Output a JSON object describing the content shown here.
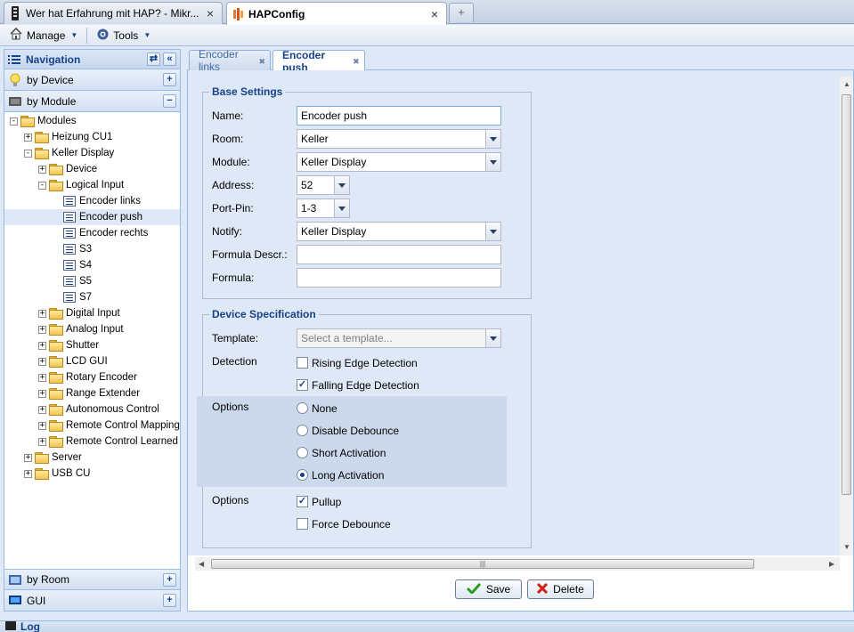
{
  "browser": {
    "tabs": [
      {
        "title": "Wer hat Erfahrung mit HAP? - Mikr...",
        "close": "×"
      },
      {
        "title": "HAPConfig",
        "close": "×"
      }
    ],
    "new_tab": "+"
  },
  "toolbar": {
    "manage": "Manage",
    "tools": "Tools"
  },
  "navigation": {
    "title": "Navigation",
    "sections": {
      "by_device": "by Device",
      "by_module": "by Module",
      "by_room": "by Room",
      "gui": "GUI"
    },
    "tree": [
      {
        "label": "Modules",
        "level": 0,
        "type": "folder",
        "expand": "-"
      },
      {
        "label": "Heizung CU1",
        "level": 1,
        "type": "folder",
        "expand": "+"
      },
      {
        "label": "Keller Display",
        "level": 1,
        "type": "folder",
        "expand": "-"
      },
      {
        "label": "Device",
        "level": 2,
        "type": "folder",
        "expand": "+"
      },
      {
        "label": "Logical Input",
        "level": 2,
        "type": "folder",
        "expand": "-"
      },
      {
        "label": "Encoder links",
        "level": 3,
        "type": "leaf"
      },
      {
        "label": "Encoder push",
        "level": 3,
        "type": "leaf",
        "selected": true
      },
      {
        "label": "Encoder rechts",
        "level": 3,
        "type": "leaf"
      },
      {
        "label": "S3",
        "level": 3,
        "type": "leaf"
      },
      {
        "label": "S4",
        "level": 3,
        "type": "leaf"
      },
      {
        "label": "S5",
        "level": 3,
        "type": "leaf"
      },
      {
        "label": "S7",
        "level": 3,
        "type": "leaf"
      },
      {
        "label": "Digital Input",
        "level": 2,
        "type": "folder",
        "expand": "+"
      },
      {
        "label": "Analog Input",
        "level": 2,
        "type": "folder",
        "expand": "+"
      },
      {
        "label": "Shutter",
        "level": 2,
        "type": "folder",
        "expand": "+"
      },
      {
        "label": "LCD GUI",
        "level": 2,
        "type": "folder",
        "expand": "+"
      },
      {
        "label": "Rotary Encoder",
        "level": 2,
        "type": "folder",
        "expand": "+"
      },
      {
        "label": "Range Extender",
        "level": 2,
        "type": "folder",
        "expand": "+"
      },
      {
        "label": "Autonomous Control",
        "level": 2,
        "type": "folder",
        "expand": "+"
      },
      {
        "label": "Remote Control Mapping",
        "level": 2,
        "type": "folder",
        "expand": "+"
      },
      {
        "label": "Remote Control Learned",
        "level": 2,
        "type": "folder",
        "expand": "+"
      },
      {
        "label": "Server",
        "level": 1,
        "type": "folder",
        "expand": "+"
      },
      {
        "label": "USB CU",
        "level": 1,
        "type": "folder",
        "expand": "+"
      }
    ]
  },
  "tabs": [
    {
      "label": "Encoder links"
    },
    {
      "label": "Encoder push"
    }
  ],
  "base_settings": {
    "legend": "Base Settings",
    "name_label": "Name:",
    "name_value": "Encoder push",
    "room_label": "Room:",
    "room_value": "Keller",
    "module_label": "Module:",
    "module_value": "Keller Display",
    "address_label": "Address:",
    "address_value": "52",
    "portpin_label": "Port-Pin:",
    "portpin_value": "1-3",
    "notify_label": "Notify:",
    "notify_value": "Keller Display",
    "formula_descr_label": "Formula Descr.:",
    "formula_descr_value": "",
    "formula_label": "Formula:",
    "formula_value": ""
  },
  "device_spec": {
    "legend": "Device Specification",
    "template_label": "Template:",
    "template_placeholder": "Select a template...",
    "detection_label": "Detection",
    "rising": {
      "label": "Rising Edge Detection",
      "checked": false
    },
    "falling": {
      "label": "Falling Edge Detection",
      "checked": true
    },
    "options_label": "Options",
    "radios": [
      {
        "label": "None",
        "selected": false
      },
      {
        "label": "Disable Debounce",
        "selected": false
      },
      {
        "label": "Short Activation",
        "selected": false
      },
      {
        "label": "Long Activation",
        "selected": true
      }
    ],
    "options2_label": "Options",
    "pullup": {
      "label": "Pullup",
      "checked": true
    },
    "force_debounce": {
      "label": "Force Debounce",
      "checked": false
    }
  },
  "actions": {
    "save": "Save",
    "delete": "Delete"
  },
  "log": {
    "title": "Log"
  },
  "colors": {
    "header_text": "#15428b",
    "panel_bg": "#dfe8f6"
  }
}
